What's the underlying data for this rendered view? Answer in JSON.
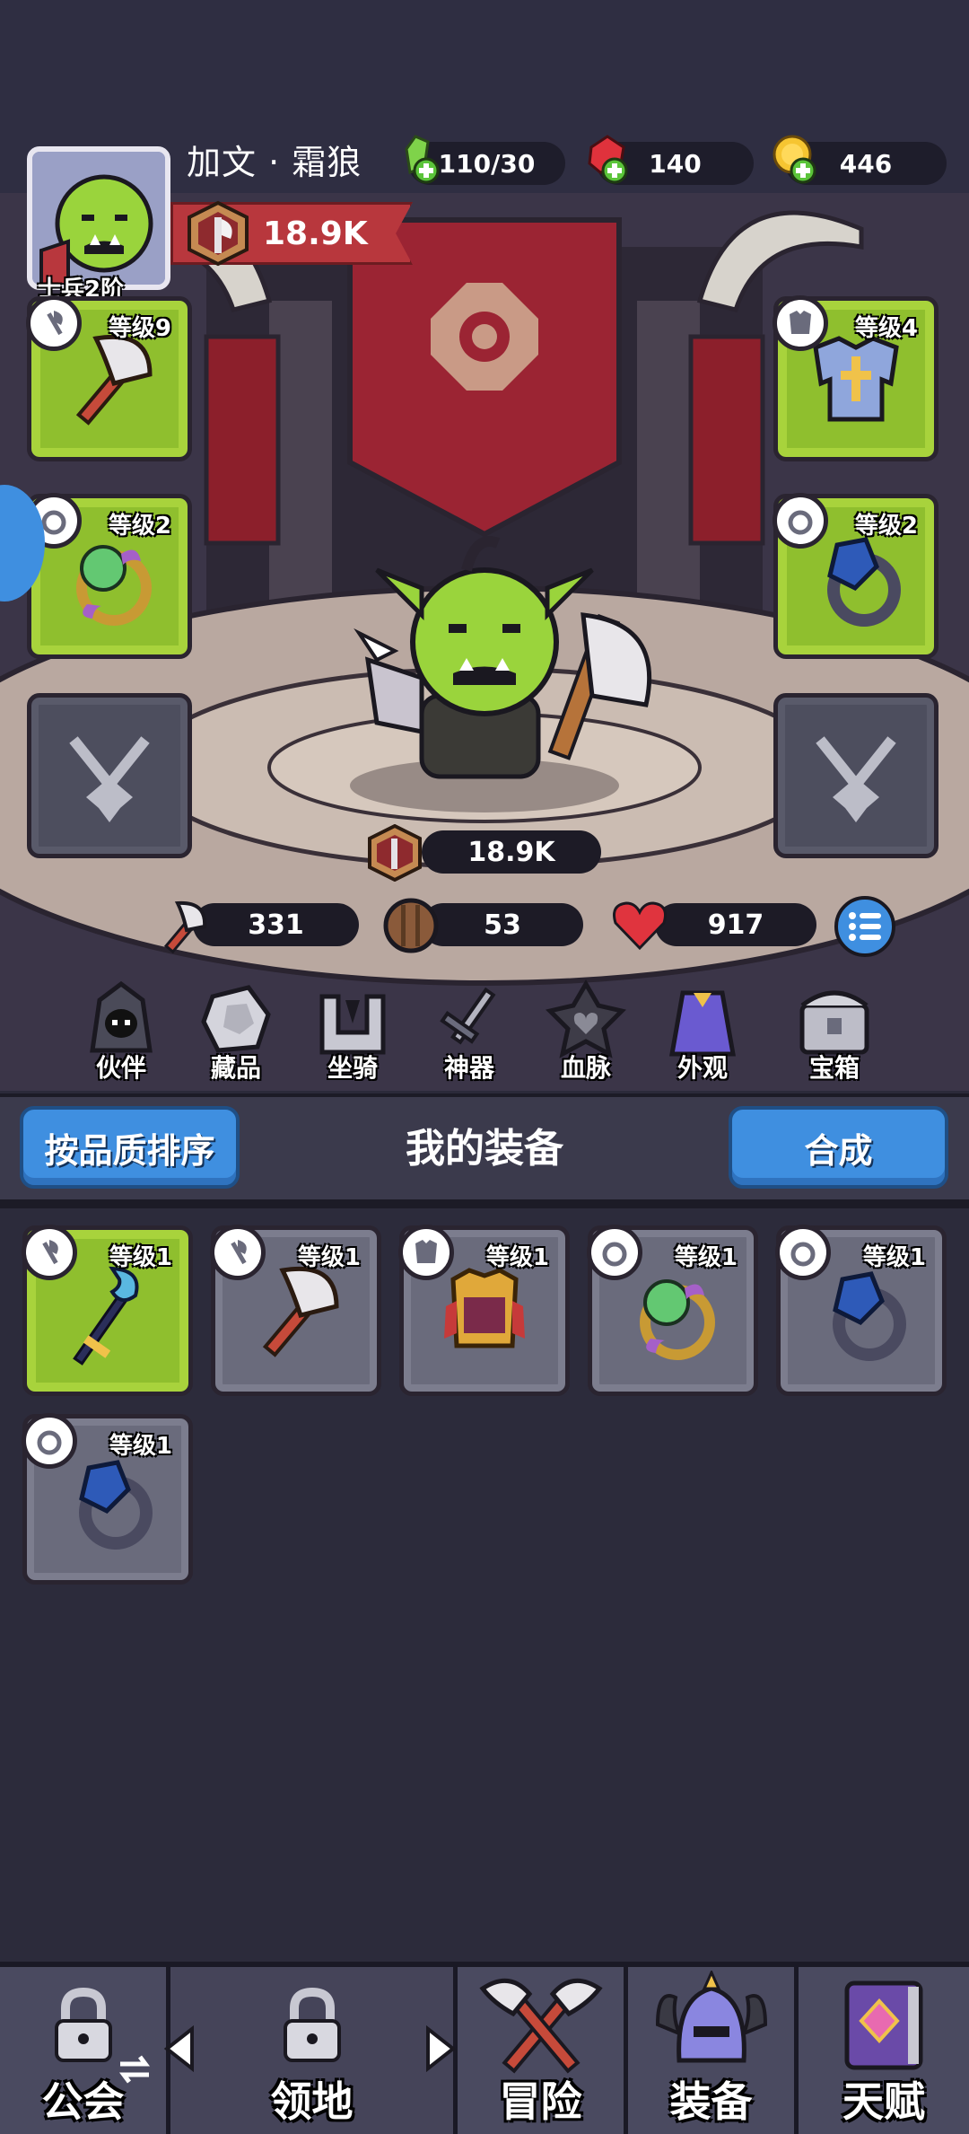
{
  "hero": {
    "name": "加文 · 霜狼",
    "rank": "士兵2阶",
    "power": "18.9K"
  },
  "resources": [
    {
      "name": "energy",
      "value": "110/30",
      "icon": "green-crystal-icon"
    },
    {
      "name": "gems",
      "value": "140",
      "icon": "red-gem-icon"
    },
    {
      "name": "gold",
      "value": "446",
      "icon": "gold-coin-icon"
    }
  ],
  "equipped": {
    "left": [
      {
        "slot": "weapon",
        "level": "等级9",
        "icon": "axe-icon"
      },
      {
        "slot": "ring",
        "level": "等级2",
        "icon": "ring-icon"
      }
    ],
    "right": [
      {
        "slot": "armor",
        "level": "等级4",
        "icon": "armor-icon"
      },
      {
        "slot": "ring",
        "level": "等级2",
        "icon": "ring-icon"
      }
    ]
  },
  "stats": {
    "power": "18.9K",
    "attack": "331",
    "defense": "53",
    "health": "917"
  },
  "menu": [
    {
      "label": "伙伴",
      "icon": "hooded-companion-icon"
    },
    {
      "label": "藏品",
      "icon": "stone-collection-icon"
    },
    {
      "label": "坐骑",
      "icon": "mount-icon"
    },
    {
      "label": "神器",
      "icon": "artifact-sword-icon"
    },
    {
      "label": "血脉",
      "icon": "bloodline-icon"
    },
    {
      "label": "外观",
      "icon": "cape-appearance-icon"
    },
    {
      "label": "宝箱",
      "icon": "treasure-chest-icon"
    }
  ],
  "equipment_panel": {
    "sort_button": "按品质排序",
    "title": "我的装备",
    "merge_button": "合成"
  },
  "inventory": [
    {
      "level": "等级1",
      "item": "staff",
      "quality": "green"
    },
    {
      "level": "等级1",
      "item": "axe",
      "quality": "grey"
    },
    {
      "level": "等级1",
      "item": "gold-armor",
      "quality": "grey"
    },
    {
      "level": "等级1",
      "item": "orb-ring",
      "quality": "grey"
    },
    {
      "level": "等级1",
      "item": "sapphire-ring",
      "quality": "grey"
    },
    {
      "level": "等级1",
      "item": "sapphire-ring",
      "quality": "grey"
    }
  ],
  "bottom_nav": [
    {
      "label": "公会",
      "locked": true
    },
    {
      "label": "领地",
      "locked": true
    },
    {
      "label": "冒险",
      "locked": false
    },
    {
      "label": "装备",
      "locked": false
    },
    {
      "label": "天赋",
      "locked": false
    }
  ],
  "colors": {
    "accent_blue": "#3f8fe0",
    "slot_green": "#8fbf2e",
    "ribbon_red": "#b8373d",
    "background": "#2b2a3a"
  }
}
